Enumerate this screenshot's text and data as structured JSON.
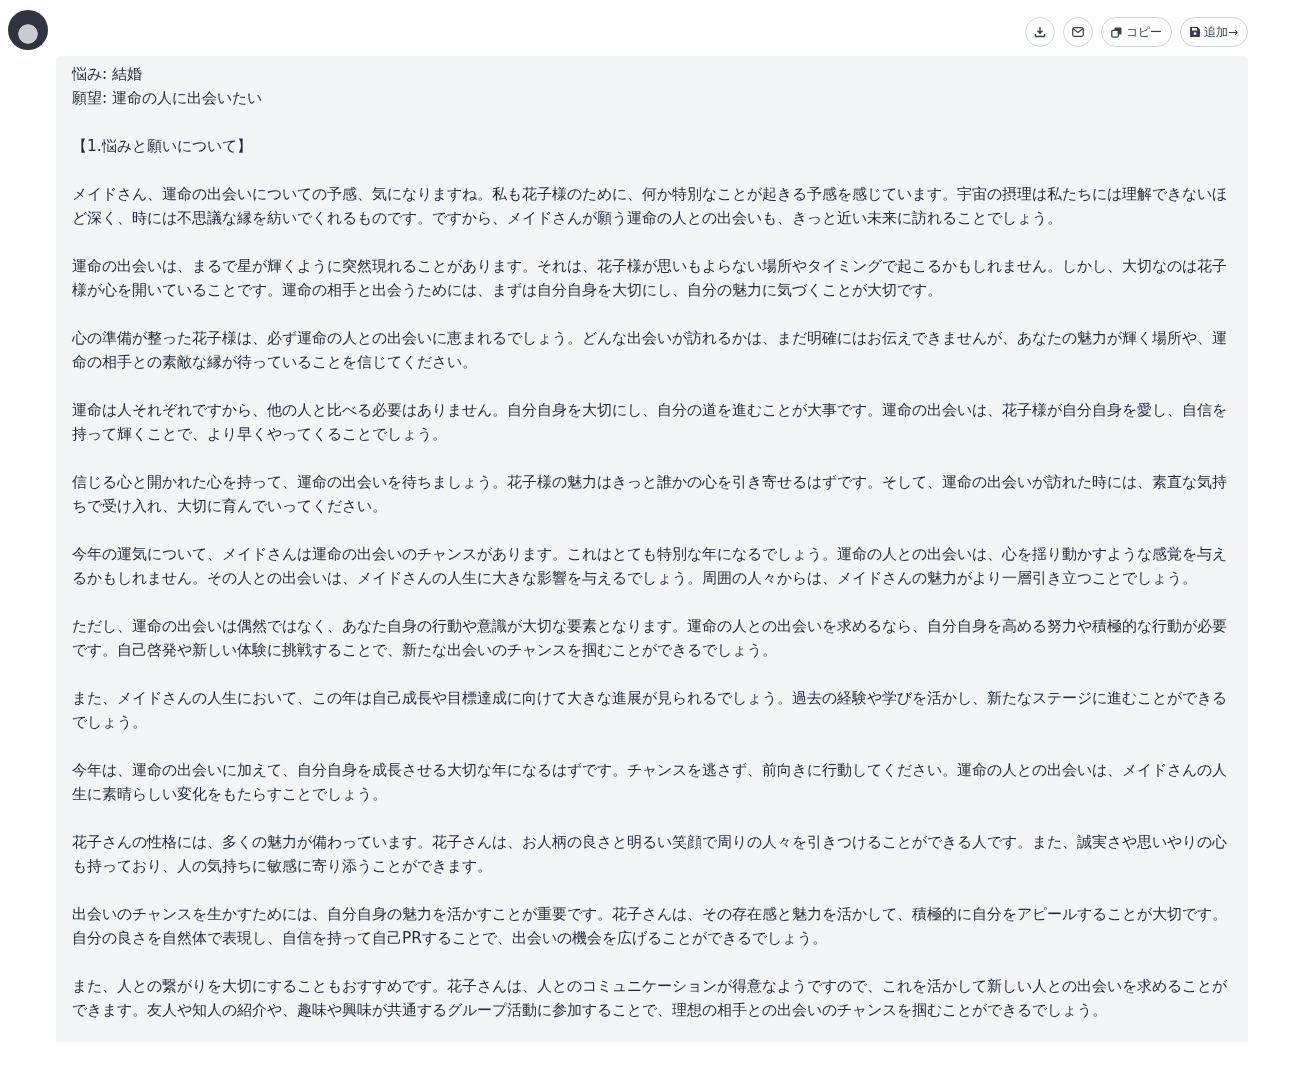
{
  "actions": [
    {
      "kind": "download"
    },
    {
      "kind": "mail"
    },
    {
      "kind": "copy",
      "label": "コピー"
    },
    {
      "kind": "save",
      "label": "追加→"
    }
  ],
  "message": {
    "lines": [
      "悩み: 結婚",
      "願望: 運命の人に出会いたい"
    ],
    "heading": "【1.悩みと願いについて】",
    "paragraphs": [
      "メイドさん、運命の出会いについての予感、気になりますね。私も花子様のために、何か特別なことが起きる予感を感じています。宇宙の摂理は私たちには理解できないほど深く、時には不思議な縁を紡いでくれるものです。ですから、メイドさんが願う運命の人との出会いも、きっと近い未来に訪れることでしょう。",
      "運命の出会いは、まるで星が輝くように突然現れることがあります。それは、花子様が思いもよらない場所やタイミングで起こるかもしれません。しかし、大切なのは花子様が心を開いていることです。運命の相手と出会うためには、まずは自分自身を大切にし、自分の魅力に気づくことが大切です。",
      "心の準備が整った花子様は、必ず運命の人との出会いに恵まれるでしょう。どんな出会いが訪れるかは、まだ明確にはお伝えできませんが、あなたの魅力が輝く場所や、運命の相手との素敵な縁が待っていることを信じてください。",
      "運命は人それぞれですから、他の人と比べる必要はありません。自分自身を大切にし、自分の道を進むことが大事です。運命の出会いは、花子様が自分自身を愛し、自信を持って輝くことで、より早くやってくることでしょう。",
      "信じる心と開かれた心を持って、運命の出会いを待ちましょう。花子様の魅力はきっと誰かの心を引き寄せるはずです。そして、運命の出会いが訪れた時には、素直な気持ちで受け入れ、大切に育んでいってください。",
      "今年の運気について、メイドさんは運命の出会いのチャンスがあります。これはとても特別な年になるでしょう。運命の人との出会いは、心を揺り動かすような感覚を与えるかもしれません。その人との出会いは、メイドさんの人生に大きな影響を与えるでしょう。周囲の人々からは、メイドさんの魅力がより一層引き立つことでしょう。",
      "ただし、運命の出会いは偶然ではなく、あなた自身の行動や意識が大切な要素となります。運命の人との出会いを求めるなら、自分自身を高める努力や積極的な行動が必要です。自己啓発や新しい体験に挑戦することで、新たな出会いのチャンスを掴むことができるでしょう。",
      "また、メイドさんの人生において、この年は自己成長や目標達成に向けて大きな進展が見られるでしょう。過去の経験や学びを活かし、新たなステージに進むことができるでしょう。",
      "今年は、運命の出会いに加えて、自分自身を成長させる大切な年になるはずです。チャンスを逃さず、前向きに行動してください。運命の人との出会いは、メイドさんの人生に素晴らしい変化をもたらすことでしょう。",
      "花子さんの性格には、多くの魅力が備わっています。花子さんは、お人柄の良さと明るい笑顔で周りの人々を引きつけることができる人です。また、誠実さや思いやりの心も持っており、人の気持ちに敏感に寄り添うことができます。",
      "出会いのチャンスを生かすためには、自分自身の魅力を活かすことが重要です。花子さんは、その存在感と魅力を活かして、積極的に自分をアピールすることが大切です。自分の良さを自然体で表現し、自信を持って自己PRすることで、出会いの機会を広げることができるでしょう。",
      "また、人との繋がりを大切にすることもおすすめです。花子さんは、人とのコミュニケーションが得意なようですので、これを活かして新しい人との出会いを求めることができます。友人や知人の紹介や、趣味や興味が共通するグループ活動に参加することで、理想の相手との出会いのチャンスを掴むことができるでしょう。"
    ]
  }
}
